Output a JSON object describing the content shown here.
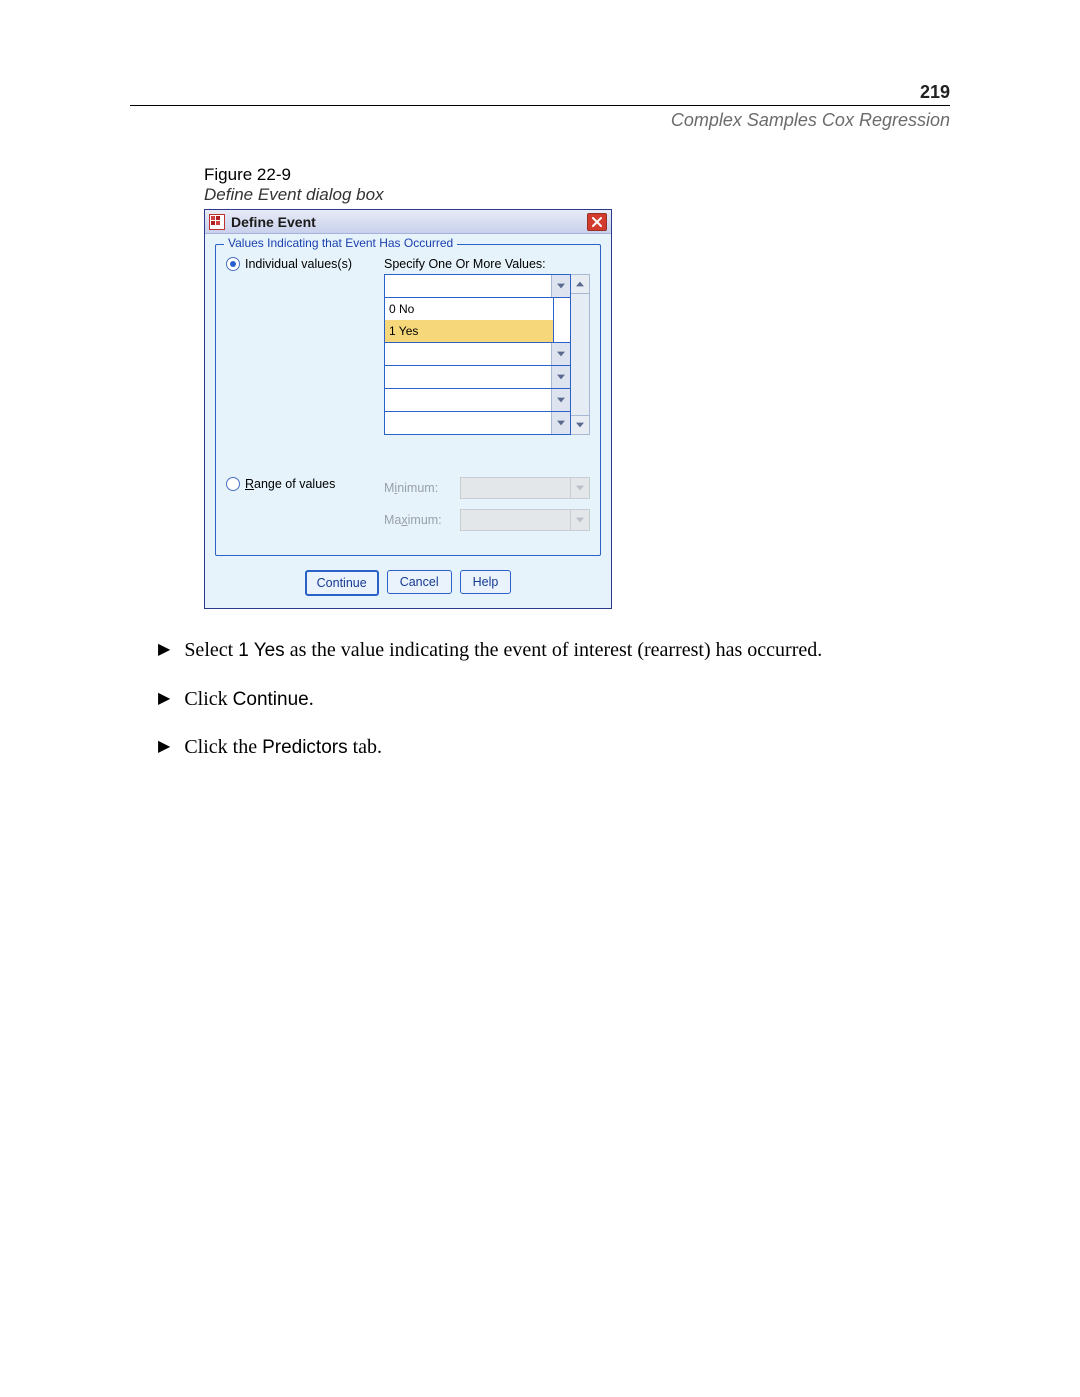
{
  "page_number": "219",
  "chapter_title": "Complex Samples Cox Regression",
  "figure_label": "Figure 22-9",
  "figure_caption": "Define Event dialog box",
  "dialog": {
    "title": "Define Event",
    "fieldset_legend": "Values Indicating that Event Has Occurred",
    "radio_individual": "Individual values(s)",
    "radio_range_pre": "R",
    "radio_range_post": "ange of values",
    "specify_label": "Specify One Or More Values:",
    "dropdown_options": [
      "0 No",
      "1 Yes"
    ],
    "range": {
      "min_pre": "M",
      "min_under": "i",
      "min_post": "nimum:",
      "max_pre": "Ma",
      "max_under": "x",
      "max_post": "imum:"
    },
    "buttons": {
      "continue": "Continue",
      "cancel": "Cancel",
      "help": "Help"
    }
  },
  "instructions": {
    "item1_pre": "Select ",
    "item1_sans": "1 Yes",
    "item1_post": " as the value indicating the event of interest (rearrest) has occurred.",
    "item2_pre": "Click ",
    "item2_sans": "Continue",
    "item2_post": ".",
    "item3_pre": "Click the ",
    "item3_sans": "Predictors",
    "item3_post": " tab."
  }
}
